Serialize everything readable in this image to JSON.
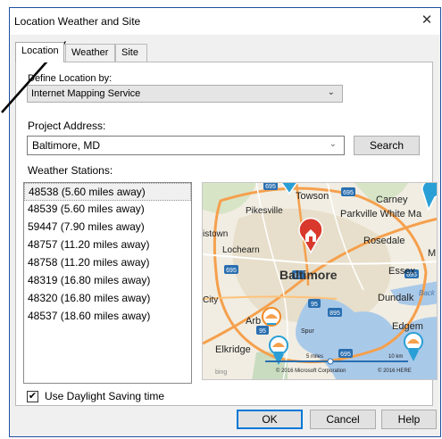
{
  "window": {
    "title": "Location Weather and Site",
    "close_glyph": "✕"
  },
  "tabs": [
    {
      "label": "Location",
      "active": true
    },
    {
      "label": "Weather",
      "active": false
    },
    {
      "label": "Site",
      "active": false
    }
  ],
  "define_location": {
    "label": "Define Location by:",
    "value": "Internet Mapping Service"
  },
  "project_address": {
    "label": "Project Address:",
    "value": "Baltimore, MD",
    "search_label": "Search"
  },
  "weather_stations": {
    "label": "Weather Stations:",
    "items": [
      "48538 (5.60 miles away)",
      "48539 (5.60 miles away)",
      "59447 (7.90 miles away)",
      "48757 (11.20 miles away)",
      "48758 (11.20 miles away)",
      "48319 (16.80 miles away)",
      "48320 (16.80 miles away)",
      "48537 (18.60 miles away)"
    ],
    "selected_index": 0
  },
  "map": {
    "places": {
      "towson": "Towson",
      "carney": "Carney",
      "pikesville": "Pikesville",
      "parkville": "Parkville White Ma",
      "istown": "istown",
      "rosedale": "Rosedale",
      "m": "M",
      "lochearn": "Lochearn",
      "baltimore": "Baltimore",
      "essex": "Essex",
      "city": "City",
      "dundalk": "Dundalk",
      "back_river": "Back River",
      "arb": "Arb",
      "spur": "Spur",
      "edgem": "Edgem",
      "elkridge": "Elkridge"
    },
    "scale_miles": "5 miles",
    "scale_km": "10 km",
    "attribution_ms": "© 2016 Microsoft Corporation",
    "attribution_here": "© 2016 HERE",
    "logo": "bing",
    "routes": [
      "695",
      "695",
      "695",
      "695",
      "83",
      "95",
      "895",
      "95",
      "695"
    ],
    "colors": {
      "water": "#a9c9e9",
      "land": "#f1ede2",
      "urban": "#e7dfcb",
      "highway": "#f5a04d",
      "pin_home": "#d9382c",
      "pin_station": "#2a9fd6"
    }
  },
  "daylight_saving": {
    "label": "Use Daylight Saving time",
    "checked": true
  },
  "buttons": {
    "ok": "OK",
    "cancel": "Cancel",
    "help": "Help"
  }
}
